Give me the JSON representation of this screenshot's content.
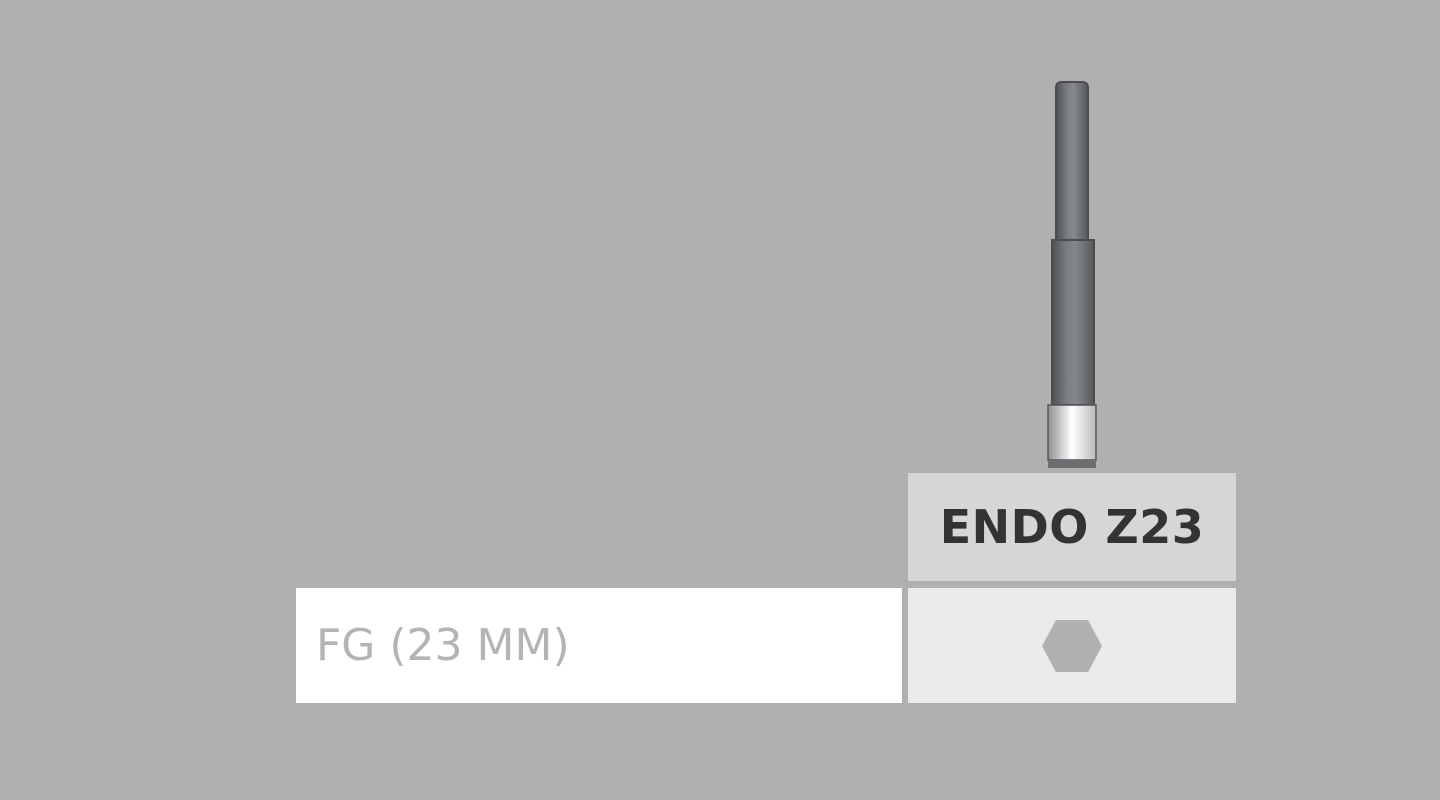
{
  "product": {
    "name": "ENDO Z23",
    "image_icon": "dental-bur-icon"
  },
  "shank_row": {
    "label": "FG (23 MM)",
    "indicator_icon": "hexagon-icon",
    "indicator_color": "#b0b0b0"
  },
  "colors": {
    "background": "#b0b0b0",
    "header_bg": "#d6d6d6",
    "label_cell_bg": "#ffffff",
    "value_cell_bg": "#ebebeb",
    "name_text": "#333333",
    "label_text": "#b4b4b4"
  }
}
